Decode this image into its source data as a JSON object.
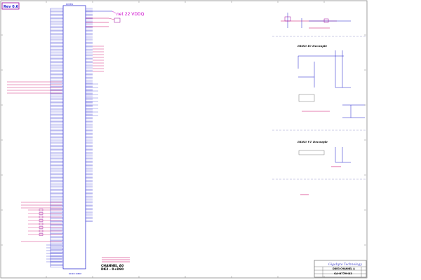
{
  "page": {
    "revision": "Rev 0.6"
  },
  "annotations": {
    "net_note": "net 22 VDDQ"
  },
  "sections": {
    "decouple_1": "DDR3 IO Decouple",
    "decouple_2": "DDR3 VT Decouple"
  },
  "main_block": {
    "channel_label": "CHANNEL A0",
    "channel_sub": "DK2 - 0+D90"
  },
  "title_block": {
    "company": "Gigabyte Technology",
    "sheet_title": "DDR3 CHANNEL A",
    "doc_number": "GA-H77M-D3"
  },
  "colors": {
    "wire": "#1a1acc",
    "net": "#cc0066",
    "component": "#990099",
    "border": "#555555",
    "divider": "#9999cc"
  }
}
